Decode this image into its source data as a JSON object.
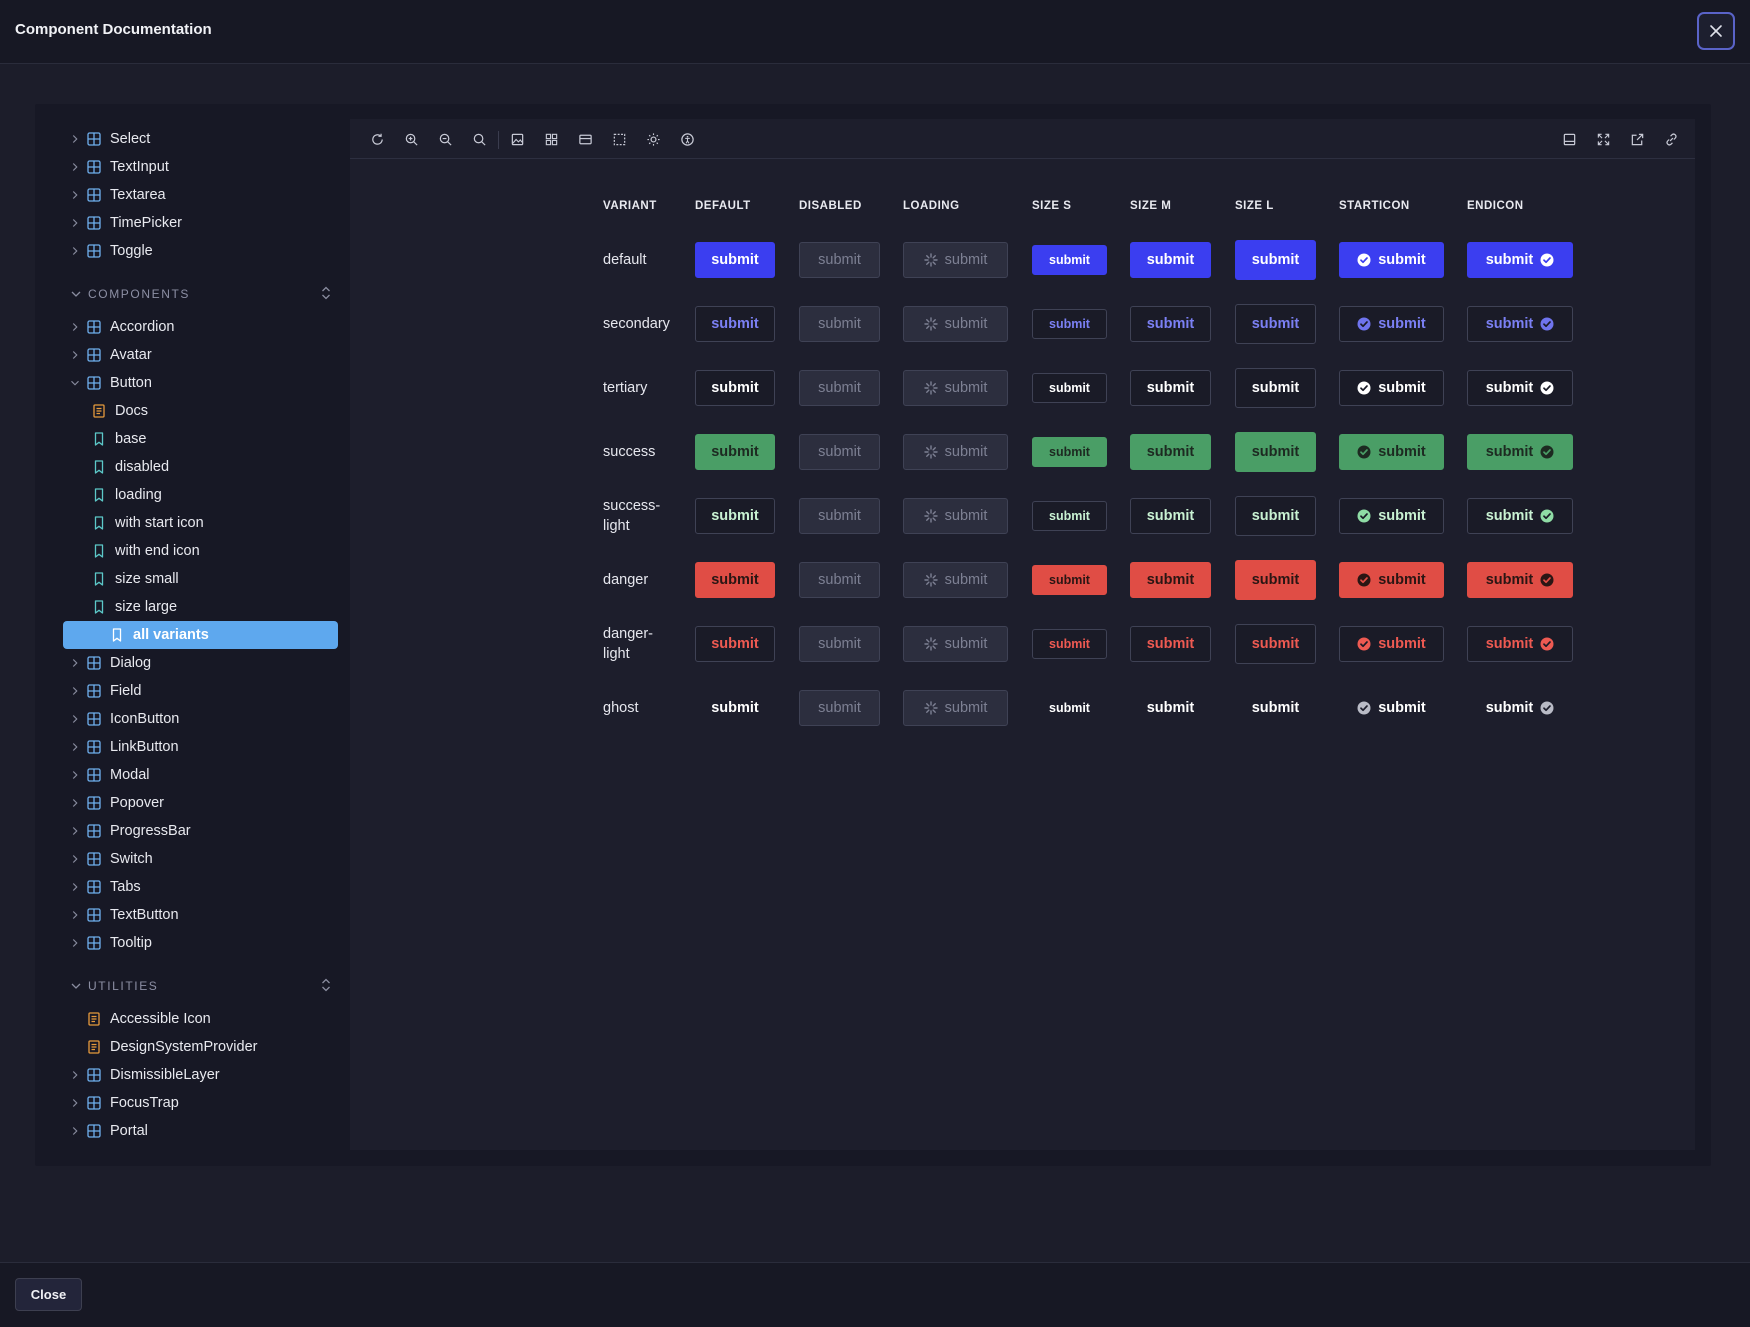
{
  "window": {
    "title": "Component Documentation"
  },
  "footer": {
    "close_label": "Close"
  },
  "sidebar": {
    "top_items": [
      {
        "label": "Select"
      },
      {
        "label": "TextInput"
      },
      {
        "label": "Textarea"
      },
      {
        "label": "TimePicker"
      },
      {
        "label": "Toggle"
      }
    ],
    "components_header": "COMPONENTS",
    "components": [
      {
        "label": "Accordion"
      },
      {
        "label": "Avatar"
      },
      {
        "label": "Button"
      }
    ],
    "button_children": [
      {
        "label": "Docs",
        "icon": "doc-icon"
      },
      {
        "label": "base",
        "icon": "story-icon"
      },
      {
        "label": "disabled",
        "icon": "story-icon"
      },
      {
        "label": "loading",
        "icon": "story-icon"
      },
      {
        "label": "with start icon",
        "icon": "story-icon"
      },
      {
        "label": "with end icon",
        "icon": "story-icon"
      },
      {
        "label": "size small",
        "icon": "story-icon"
      },
      {
        "label": "size large",
        "icon": "story-icon"
      },
      {
        "label": "all variants",
        "icon": "story-icon",
        "selected": true
      }
    ],
    "components_after": [
      {
        "label": "Dialog"
      },
      {
        "label": "Field"
      },
      {
        "label": "IconButton"
      },
      {
        "label": "LinkButton"
      },
      {
        "label": "Modal"
      },
      {
        "label": "Popover"
      },
      {
        "label": "ProgressBar"
      },
      {
        "label": "Switch"
      },
      {
        "label": "Tabs"
      },
      {
        "label": "TextButton"
      },
      {
        "label": "Tooltip"
      }
    ],
    "utilities_header": "UTILITIES",
    "utilities": [
      {
        "label": "Accessible Icon",
        "icon": "doc-icon"
      },
      {
        "label": "DesignSystemProvider",
        "icon": "doc-icon"
      },
      {
        "label": "DismissibleLayer",
        "icon": "component-icon"
      },
      {
        "label": "FocusTrap",
        "icon": "component-icon"
      },
      {
        "label": "Portal",
        "icon": "component-icon"
      }
    ]
  },
  "toolbar": {
    "left_icons": [
      "reload-icon",
      "zoom-in-icon",
      "zoom-out-icon",
      "zoom-reset-icon",
      "image-icon",
      "grid-icon",
      "background-icon",
      "outline-icon",
      "theme-icon",
      "accessibility-icon"
    ],
    "right_icons": [
      "panel-icon",
      "fullscreen-icon",
      "open-new-tab-icon",
      "copy-link-icon"
    ]
  },
  "matrix": {
    "columns": [
      "VARIANT",
      "DEFAULT",
      "DISABLED",
      "LOADING",
      "SIZE S",
      "SIZE M",
      "SIZE L",
      "STARTICON",
      "ENDICON"
    ],
    "button_label": "submit",
    "rows": [
      {
        "label": "default",
        "style": "filled",
        "bg": "#3b3ef0",
        "fg": "#ffffff",
        "border": "#3b3ef0",
        "icon_fill": "#ffffff",
        "icon_mark": "#3b3ef0"
      },
      {
        "label": "secondary",
        "style": "outline",
        "bg": "#1a1b27",
        "fg": "#7b80f4",
        "border": "#3f4255",
        "icon_fill": "#6f74ee",
        "icon_mark": "#1a1b27"
      },
      {
        "label": "tertiary",
        "style": "outline",
        "bg": "#1a1b27",
        "fg": "#ffffff",
        "border": "#3f4255",
        "icon_fill": "#ffffff",
        "icon_mark": "#1a1b27"
      },
      {
        "label": "success",
        "style": "filled",
        "bg": "#4a9e66",
        "fg": "#1d2a21",
        "border": "#4a9e66",
        "icon_fill": "#1d2a21",
        "icon_mark": "#4a9e66"
      },
      {
        "label": "success-light",
        "style": "outline",
        "bg": "#1a1b27",
        "fg": "#c9f2d3",
        "border": "#3f4255",
        "icon_fill": "#8fdca5",
        "icon_mark": "#1a1b27"
      },
      {
        "label": "danger",
        "style": "filled",
        "bg": "#e04d45",
        "fg": "#2a1614",
        "border": "#e04d45",
        "icon_fill": "#2a1614",
        "icon_mark": "#e04d45"
      },
      {
        "label": "danger-light",
        "style": "outline",
        "bg": "#1a1b27",
        "fg": "#ee5a52",
        "border": "#3f4255",
        "icon_fill": "#ee5a52",
        "icon_mark": "#1a1b27"
      },
      {
        "label": "ghost",
        "style": "ghost",
        "bg": "transparent",
        "fg": "#ffffff",
        "border": "transparent",
        "icon_fill": "#b9bbc6",
        "icon_mark": "#1d1e2c"
      }
    ],
    "disabled_colors": {
      "bg": "#2c2e3e",
      "fg": "#7d8093",
      "border": "#3f4255"
    }
  }
}
